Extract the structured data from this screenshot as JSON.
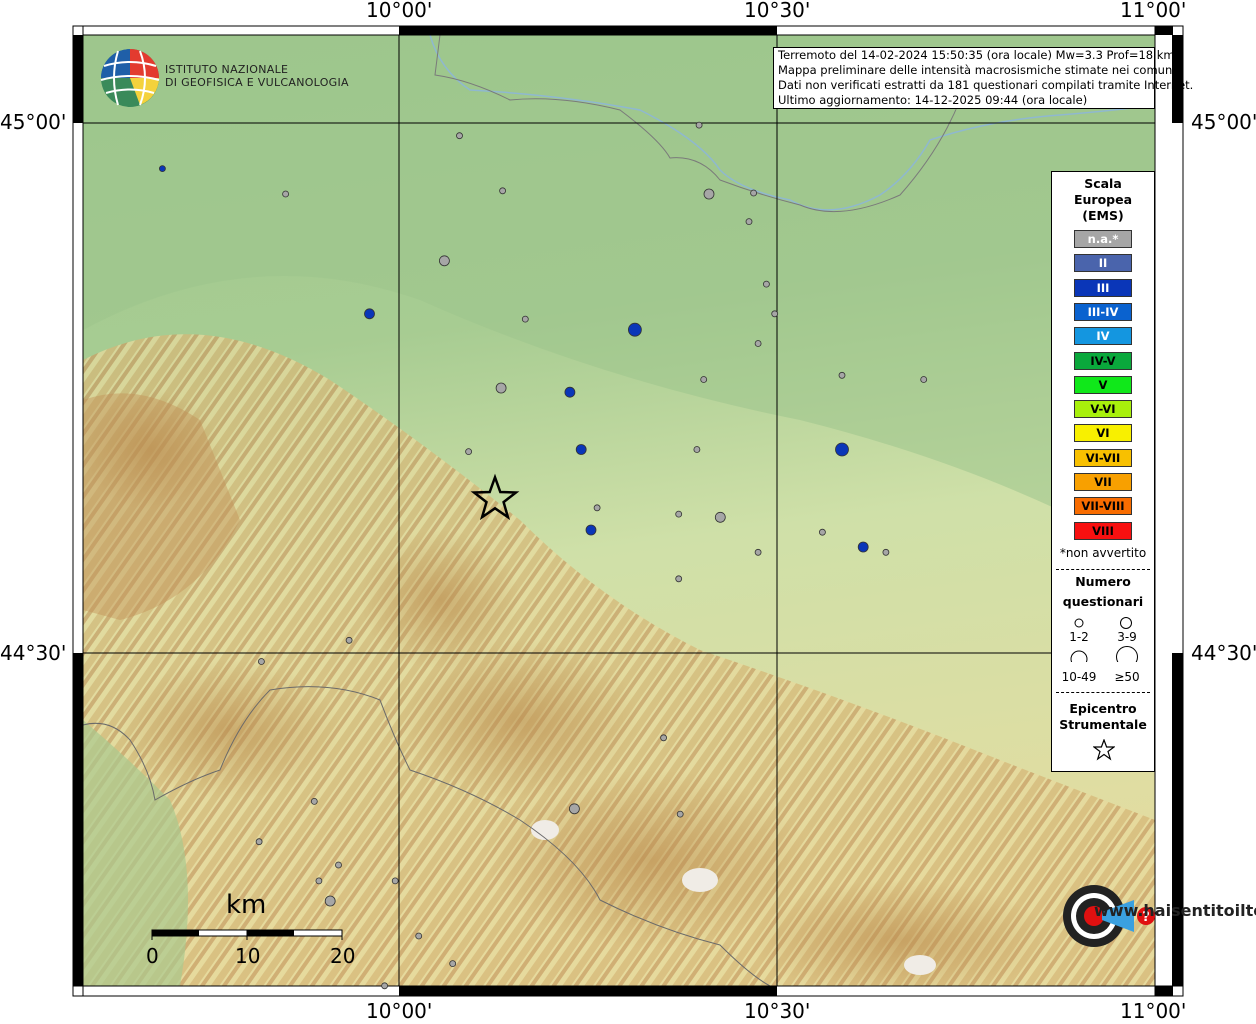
{
  "coords": {
    "lon": [
      "10°00'",
      "10°30'",
      "11°00'"
    ],
    "lat": [
      "45°00'",
      "44°30'"
    ]
  },
  "info": {
    "line1": "Terremoto del 14-02-2024 15:50:35 (ora locale) Mw=3.3 Prof=18 km",
    "line2": "Mappa preliminare delle intensità macrosismiche stimate nei comuni",
    "line3": "Dati non verificati estratti da 181 questionari compilati tramite Internet.",
    "line4": "Ultimo aggiornamento: 14-12-2025 09:44 (ora locale)"
  },
  "logo": {
    "line1": "ISTITUTO NAZIONALE",
    "line2": "DI GEOFISICA E VULCANOLOGIA"
  },
  "legend": {
    "title1": "Scala",
    "title2": "Europea",
    "title3": "(EMS)",
    "classes": [
      {
        "label": "n.a.*",
        "color": "#a6a6a6"
      },
      {
        "label": "II",
        "color": "#4a64ac"
      },
      {
        "label": "III",
        "color": "#0a36b8"
      },
      {
        "label": "III-IV",
        "color": "#0a62cf"
      },
      {
        "label": "IV",
        "color": "#1496e0"
      },
      {
        "label": "IV-V",
        "color": "#0aa83c"
      },
      {
        "label": "V",
        "color": "#10e81a"
      },
      {
        "label": "V-VI",
        "color": "#a8f00c"
      },
      {
        "label": "VI",
        "color": "#f8f000"
      },
      {
        "label": "VI-VII",
        "color": "#f8c000"
      },
      {
        "label": "VII",
        "color": "#f8a000"
      },
      {
        "label": "VII-VIII",
        "color": "#f86c00"
      },
      {
        "label": "VIII",
        "color": "#f81010"
      }
    ],
    "note": "*non avvertito",
    "count_title1": "Numero",
    "count_title2": "questionari",
    "counts": [
      "1-2",
      "3-9",
      "10-49",
      "≥50"
    ],
    "epi1": "Epicentro",
    "epi2": "Strumentale"
  },
  "scale": {
    "unit": "km",
    "ticks": [
      "0",
      "10",
      "20"
    ]
  },
  "watermark": {
    "text": "www.haisentitoilterremoto.it"
  },
  "colors": {
    "blue": "#0a36b8",
    "gray": "#a6a6a6"
  },
  "points": [
    {
      "lon": 9.687,
      "lat": 44.957,
      "c": "blue",
      "n": 1
    },
    {
      "lon": 9.85,
      "lat": 44.933,
      "c": "gray",
      "n": 1
    },
    {
      "lon": 9.961,
      "lat": 44.82,
      "c": "blue",
      "n": 3
    },
    {
      "lon": 10.08,
      "lat": 44.988,
      "c": "gray",
      "n": 1
    },
    {
      "lon": 10.137,
      "lat": 44.936,
      "c": "gray",
      "n": 1
    },
    {
      "lon": 10.06,
      "lat": 44.87,
      "c": "gray",
      "n": 3
    },
    {
      "lon": 10.167,
      "lat": 44.815,
      "c": "gray",
      "n": 1
    },
    {
      "lon": 10.312,
      "lat": 44.805,
      "c": "blue",
      "n": 10
    },
    {
      "lon": 10.135,
      "lat": 44.75,
      "c": "gray",
      "n": 3
    },
    {
      "lon": 10.226,
      "lat": 44.746,
      "c": "blue",
      "n": 3
    },
    {
      "lon": 10.092,
      "lat": 44.69,
      "c": "gray",
      "n": 1
    },
    {
      "lon": 10.241,
      "lat": 44.692,
      "c": "blue",
      "n": 3
    },
    {
      "lon": 10.262,
      "lat": 44.637,
      "c": "gray",
      "n": 1
    },
    {
      "lon": 10.254,
      "lat": 44.616,
      "c": "blue",
      "n": 3
    },
    {
      "lon": 10.37,
      "lat": 44.631,
      "c": "gray",
      "n": 1
    },
    {
      "lon": 10.397,
      "lat": 44.998,
      "c": "gray",
      "n": 1
    },
    {
      "lon": 10.41,
      "lat": 44.933,
      "c": "gray",
      "n": 3
    },
    {
      "lon": 10.469,
      "lat": 44.934,
      "c": "gray",
      "n": 1
    },
    {
      "lon": 10.463,
      "lat": 44.907,
      "c": "gray",
      "n": 1
    },
    {
      "lon": 10.486,
      "lat": 44.848,
      "c": "gray",
      "n": 1
    },
    {
      "lon": 10.497,
      "lat": 44.82,
      "c": "gray",
      "n": 1
    },
    {
      "lon": 10.475,
      "lat": 44.792,
      "c": "gray",
      "n": 1
    },
    {
      "lon": 10.403,
      "lat": 44.758,
      "c": "gray",
      "n": 1
    },
    {
      "lon": 10.394,
      "lat": 44.692,
      "c": "gray",
      "n": 1
    },
    {
      "lon": 10.425,
      "lat": 44.628,
      "c": "gray",
      "n": 3
    },
    {
      "lon": 10.37,
      "lat": 44.57,
      "c": "gray",
      "n": 1
    },
    {
      "lon": 10.475,
      "lat": 44.595,
      "c": "gray",
      "n": 1
    },
    {
      "lon": 10.56,
      "lat": 44.614,
      "c": "gray",
      "n": 1
    },
    {
      "lon": 10.586,
      "lat": 44.692,
      "c": "blue",
      "n": 10
    },
    {
      "lon": 10.614,
      "lat": 44.6,
      "c": "blue",
      "n": 3
    },
    {
      "lon": 10.644,
      "lat": 44.595,
      "c": "gray",
      "n": 1
    },
    {
      "lon": 10.694,
      "lat": 44.758,
      "c": "gray",
      "n": 1
    },
    {
      "lon": 10.586,
      "lat": 44.762,
      "c": "gray",
      "n": 1
    },
    {
      "lon": 9.934,
      "lat": 44.512,
      "c": "gray",
      "n": 1
    },
    {
      "lon": 9.818,
      "lat": 44.492,
      "c": "gray",
      "n": 1
    },
    {
      "lon": 9.888,
      "lat": 44.36,
      "c": "gray",
      "n": 1
    },
    {
      "lon": 9.815,
      "lat": 44.322,
      "c": "gray",
      "n": 1
    },
    {
      "lon": 9.92,
      "lat": 44.3,
      "c": "gray",
      "n": 1
    },
    {
      "lon": 9.894,
      "lat": 44.285,
      "c": "gray",
      "n": 1
    },
    {
      "lon": 9.995,
      "lat": 44.285,
      "c": "gray",
      "n": 1
    },
    {
      "lon": 9.909,
      "lat": 44.266,
      "c": "gray",
      "n": 3
    },
    {
      "lon": 10.026,
      "lat": 44.233,
      "c": "gray",
      "n": 1
    },
    {
      "lon": 10.071,
      "lat": 44.207,
      "c": "gray",
      "n": 1
    },
    {
      "lon": 9.981,
      "lat": 44.186,
      "c": "gray",
      "n": 1
    },
    {
      "lon": 10.232,
      "lat": 44.353,
      "c": "gray",
      "n": 3
    },
    {
      "lon": 10.35,
      "lat": 44.42,
      "c": "gray",
      "n": 1
    },
    {
      "lon": 10.372,
      "lat": 44.348,
      "c": "gray",
      "n": 1
    }
  ],
  "epicenter": {
    "lon": 10.127,
    "lat": 44.645
  }
}
